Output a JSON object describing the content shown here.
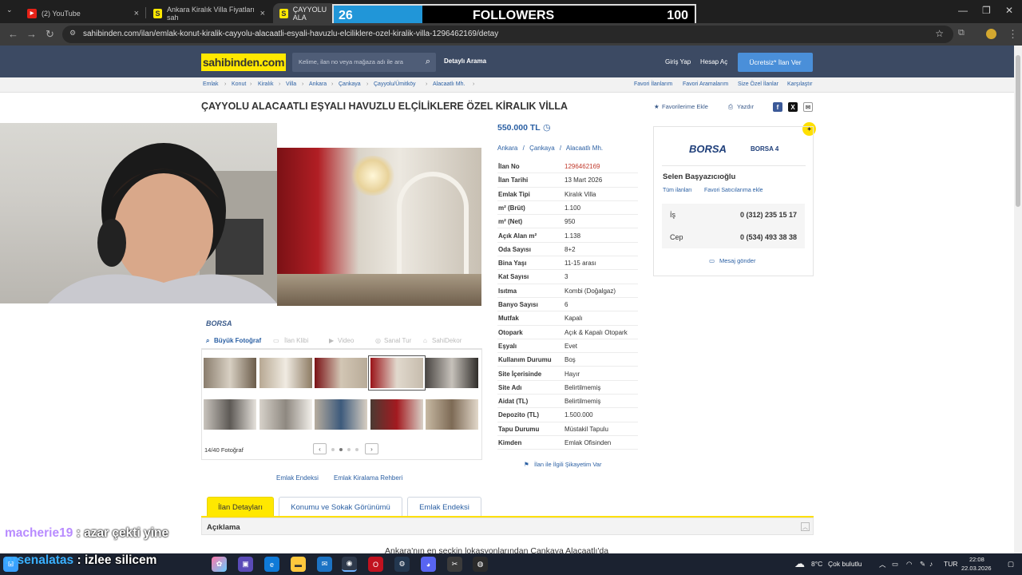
{
  "browser": {
    "tabs": [
      {
        "label": "(2) YouTube"
      },
      {
        "label": "Ankara Kiralık Villa Fiyatları sah"
      },
      {
        "label": "ÇAYYOLU ALA"
      }
    ],
    "url": "sahibinden.com/ilan/emlak-konut-kiralik-cayyolu-alacaatli-esyali-havuzlu-elciliklere-ozel-kiralik-villa-1296462169/detay"
  },
  "followers": {
    "current": "26",
    "label": "FOLLOWERS",
    "goal": "100",
    "progress": 0.26
  },
  "header": {
    "logo": "sahibinden.com",
    "search_placeholder": "Kelime, ilan no veya mağaza adı ile ara",
    "detail_search": "Detaylı Arama",
    "login": "Giriş Yap",
    "register": "Hesap Aç",
    "cta": "Ücretsiz* İlan Ver"
  },
  "breadcrumb": [
    "Emlak",
    "Konut",
    "Kiralık",
    "Villa",
    "Ankara",
    "Çankaya",
    "Çayyolu/Ümitköy",
    "Alacaatlı Mh."
  ],
  "quicklinks": [
    "Favori İlanlarım",
    "Favori Aramalarım",
    "Size Özel İlanlar",
    "Karşılaştır"
  ],
  "listing": {
    "title": "ÇAYYOLU ALACAATLI EŞYALI HAVUZLU ELÇİLİKLERE ÖZEL KİRALIK VİLLA",
    "fav": "Favorilerime Ekle",
    "print": "Yazdır",
    "price": "550.000 TL",
    "location": [
      "Ankara",
      "Çankaya",
      "Alacaatlı Mh."
    ],
    "gallery_brand": "BORSA",
    "gallery_tabs": [
      "Büyük Fotoğraf",
      "İlan Klibi",
      "Video",
      "Sanal Tur",
      "SahiDekor"
    ],
    "photo_count": "14/40 Fotoğraf",
    "links": [
      "Emlak Endeksi",
      "Emlak Kiralama Rehberi"
    ],
    "complaint": "İlan ile İlgili Şikayetim Var",
    "attributes": [
      {
        "k": "İlan No",
        "v": "1296462169"
      },
      {
        "k": "İlan Tarihi",
        "v": "13 Mart 2026"
      },
      {
        "k": "Emlak Tipi",
        "v": "Kiralık Villa"
      },
      {
        "k": "m² (Brüt)",
        "v": "1.100"
      },
      {
        "k": "m² (Net)",
        "v": "950"
      },
      {
        "k": "Açık Alan m²",
        "v": "1.138"
      },
      {
        "k": "Oda Sayısı",
        "v": "8+2"
      },
      {
        "k": "Bina Yaşı",
        "v": "11-15 arası"
      },
      {
        "k": "Kat Sayısı",
        "v": "3"
      },
      {
        "k": "Isıtma",
        "v": "Kombi (Doğalgaz)"
      },
      {
        "k": "Banyo Sayısı",
        "v": "6"
      },
      {
        "k": "Mutfak",
        "v": "Kapalı"
      },
      {
        "k": "Otopark",
        "v": "Açık & Kapalı Otopark"
      },
      {
        "k": "Eşyalı",
        "v": "Evet"
      },
      {
        "k": "Kullanım Durumu",
        "v": "Boş"
      },
      {
        "k": "Site İçerisinde",
        "v": "Hayır"
      },
      {
        "k": "Site Adı",
        "v": "Belirtilmemiş"
      },
      {
        "k": "Aidat (TL)",
        "v": "Belirtilmemiş"
      },
      {
        "k": "Depozito (TL)",
        "v": "1.500.000"
      },
      {
        "k": "Tapu Durumu",
        "v": "Müstakil Tapulu"
      },
      {
        "k": "Kimden",
        "v": "Emlak Ofisinden"
      }
    ]
  },
  "seller": {
    "brand": "BORSA",
    "store": "BORSA 4",
    "name": "Selen Başyazıcıoğlu",
    "all": "Tüm ilanları",
    "fav": "Favori Satıcılarıma ekle",
    "phones": [
      {
        "k": "İş",
        "v": "0 (312) 235 15 17"
      },
      {
        "k": "Cep",
        "v": "0 (534) 493 38 38"
      }
    ],
    "message": "Mesaj gönder"
  },
  "detail_tabs": [
    "İlan Detayları",
    "Konumu ve Sokak Görünümü",
    "Emlak Endeksi"
  ],
  "section": {
    "title": "Açıklama",
    "text": "Ankara'nın en seçkin lokasyonlarından Çankaya Alacaatlı'da"
  },
  "chat": [
    {
      "user": "macherie19",
      "msg": " : azar çekti yine"
    },
    {
      "user": "nrsenalatas",
      "msg": " : izlee silicem"
    }
  ],
  "tray": {
    "temp": "8°C",
    "weather": "Çok bulutlu",
    "lang": "TUR",
    "time": "22:08",
    "date": "22.03.2026"
  },
  "colors": {
    "header": "#3c4a63",
    "accent": "#ffe800",
    "link": "#2a5fa3",
    "cta": "#4a8fd9"
  }
}
